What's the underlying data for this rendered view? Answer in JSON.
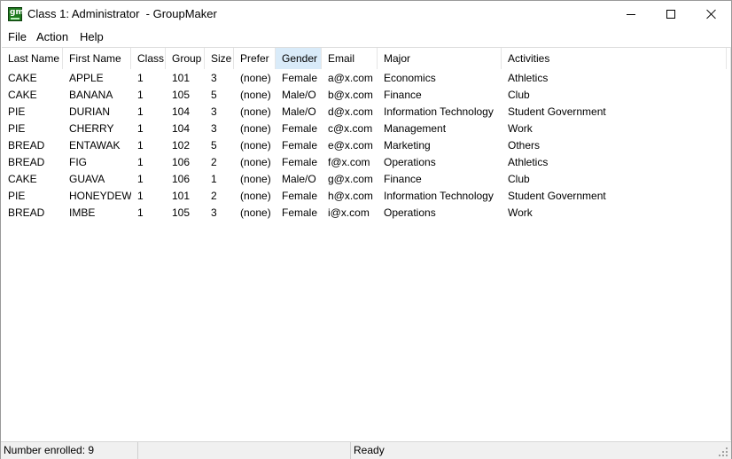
{
  "window": {
    "title": "Class 1: Administrator  - GroupMaker",
    "icon": "groupmaker-app-icon",
    "icon_text": "gm",
    "icon_color": "#1f7a1f"
  },
  "menu": {
    "file": "File",
    "action": "Action",
    "help": "Help"
  },
  "table": {
    "sorted_column": "Gender",
    "sorted_color": "#d9ebf9",
    "columns": [
      "Last Name",
      "First Name",
      "Class",
      "Group",
      "Size",
      "Prefer",
      "Gender",
      "Email",
      "Major",
      "Activities"
    ],
    "rows": [
      [
        "CAKE",
        "APPLE",
        "1",
        "101",
        "3",
        "(none)",
        "Female",
        "a@x.com",
        "Economics",
        "Athletics"
      ],
      [
        "CAKE",
        "BANANA",
        "1",
        "105",
        "5",
        "(none)",
        "Male/O",
        "b@x.com",
        "Finance",
        "Club"
      ],
      [
        "PIE",
        "DURIAN",
        "1",
        "104",
        "3",
        "(none)",
        "Male/O",
        "d@x.com",
        "Information Technology",
        "Student Government"
      ],
      [
        "PIE",
        "CHERRY",
        "1",
        "104",
        "3",
        "(none)",
        "Female",
        "c@x.com",
        "Management",
        "Work"
      ],
      [
        "BREAD",
        "ENTAWAK",
        "1",
        "102",
        "5",
        "(none)",
        "Female",
        "e@x.com",
        "Marketing",
        "Others"
      ],
      [
        "BREAD",
        "FIG",
        "1",
        "106",
        "2",
        "(none)",
        "Female",
        "f@x.com",
        "Operations",
        "Athletics"
      ],
      [
        "CAKE",
        "GUAVA",
        "1",
        "106",
        "1",
        "(none)",
        "Male/O",
        "g@x.com",
        "Finance",
        "Club"
      ],
      [
        "PIE",
        "HONEYDEW",
        "1",
        "101",
        "2",
        "(none)",
        "Female",
        "h@x.com",
        "Information Technology",
        "Student Government"
      ],
      [
        "BREAD",
        "IMBE",
        "1",
        "105",
        "3",
        "(none)",
        "Female",
        "i@x.com",
        "Operations",
        "Work"
      ]
    ]
  },
  "status": {
    "enrolled": "Number enrolled: 9",
    "middle": "",
    "state": "Ready"
  }
}
